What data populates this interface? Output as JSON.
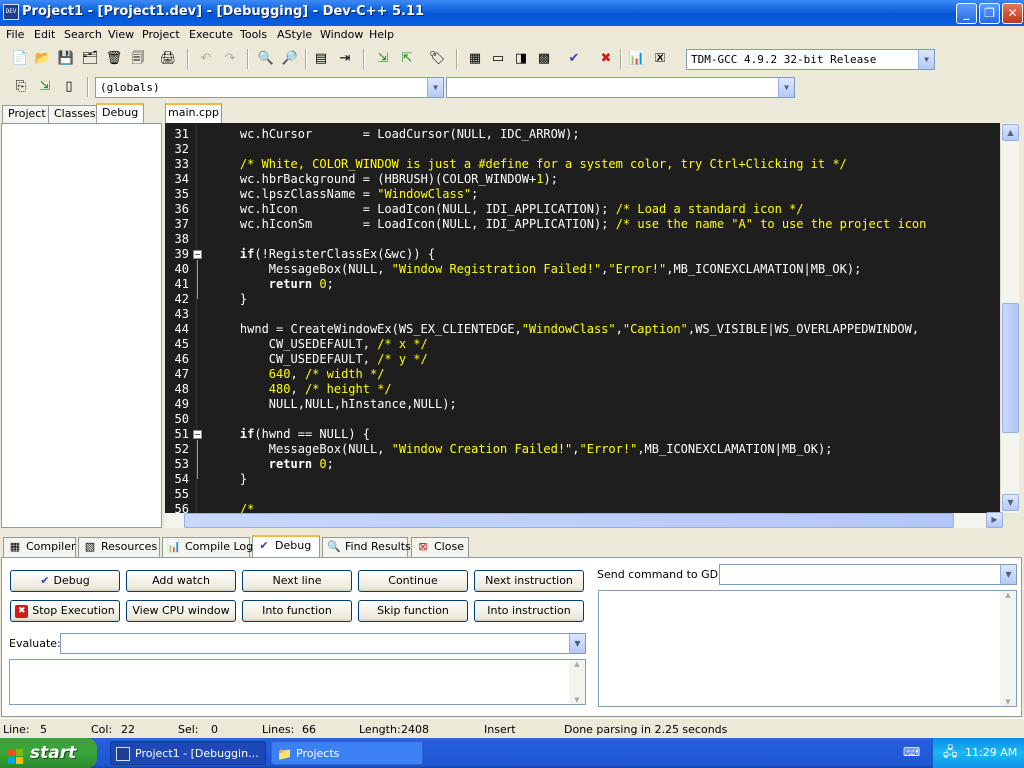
{
  "window": {
    "title": "Project1 - [Project1.dev] - [Debugging] - Dev-C++ 5.11",
    "app_icon_text": "DEV"
  },
  "menu": [
    "File",
    "Edit",
    "Search",
    "View",
    "Project",
    "Execute",
    "Tools",
    "AStyle",
    "Window",
    "Help"
  ],
  "toolbar": {
    "compiler_select": "TDM-GCC 4.9.2 32-bit Release",
    "scope_select": "(globals)",
    "member_select": ""
  },
  "left_tabs": [
    {
      "label": "Project",
      "active": false
    },
    {
      "label": "Classes",
      "active": false
    },
    {
      "label": "Debug",
      "active": true
    }
  ],
  "editor": {
    "file_tab": "main.cpp",
    "background": "#1e1e1e",
    "lines": [
      {
        "n": "31",
        "text": "    wc.hCursor       = LoadCursor(NULL, IDC_ARROW);"
      },
      {
        "n": "32",
        "text": ""
      },
      {
        "n": "33",
        "text": "    /* White, COLOR_WINDOW is just a #define for a system color, try Ctrl+Clicking it */"
      },
      {
        "n": "34",
        "text": "    wc.hbrBackground = (HBRUSH)(COLOR_WINDOW+1);"
      },
      {
        "n": "35",
        "text": "    wc.lpszClassName = \"WindowClass\";"
      },
      {
        "n": "36",
        "text": "    wc.hIcon         = LoadIcon(NULL, IDI_APPLICATION); /* Load a standard icon */"
      },
      {
        "n": "37",
        "text": "    wc.hIconSm       = LoadIcon(NULL, IDI_APPLICATION); /* use the name \"A\" to use the project icon"
      },
      {
        "n": "38",
        "text": ""
      },
      {
        "n": "39",
        "text": "    if(!RegisterClassEx(&wc)) {"
      },
      {
        "n": "40",
        "text": "        MessageBox(NULL, \"Window Registration Failed!\",\"Error!\",MB_ICONEXCLAMATION|MB_OK);"
      },
      {
        "n": "41",
        "text": "        return 0;"
      },
      {
        "n": "42",
        "text": "    }"
      },
      {
        "n": "43",
        "text": ""
      },
      {
        "n": "44",
        "text": "    hwnd = CreateWindowEx(WS_EX_CLIENTEDGE,\"WindowClass\",\"Caption\",WS_VISIBLE|WS_OVERLAPPEDWINDOW,"
      },
      {
        "n": "45",
        "text": "        CW_USEDEFAULT, /* x */"
      },
      {
        "n": "46",
        "text": "        CW_USEDEFAULT, /* y */"
      },
      {
        "n": "47",
        "text": "        640, /* width */"
      },
      {
        "n": "48",
        "text": "        480, /* height */"
      },
      {
        "n": "49",
        "text": "        NULL,NULL,hInstance,NULL);"
      },
      {
        "n": "50",
        "text": ""
      },
      {
        "n": "51",
        "text": "    if(hwnd == NULL) {"
      },
      {
        "n": "52",
        "text": "        MessageBox(NULL, \"Window Creation Failed!\",\"Error!\",MB_ICONEXCLAMATION|MB_OK);"
      },
      {
        "n": "53",
        "text": "        return 0;"
      },
      {
        "n": "54",
        "text": "    }"
      },
      {
        "n": "55",
        "text": ""
      },
      {
        "n": "56",
        "text": "    /*"
      }
    ]
  },
  "bottom_tabs": [
    {
      "label": "Compiler",
      "icon": "compiler-icon",
      "active": false
    },
    {
      "label": "Resources",
      "icon": "resources-icon",
      "active": false
    },
    {
      "label": "Compile Log",
      "icon": "compile-log-icon",
      "active": false
    },
    {
      "label": "Debug",
      "icon": "debug-check-icon",
      "active": true
    },
    {
      "label": "Find Results",
      "icon": "find-results-icon",
      "active": false
    },
    {
      "label": "Close",
      "icon": "close-tab-icon",
      "active": false
    }
  ],
  "debug_panel": {
    "buttons_row1": [
      "Debug",
      "Add watch",
      "Next line",
      "Continue",
      "Next instruction"
    ],
    "buttons_row2": [
      "Stop Execution",
      "View CPU window",
      "Into function",
      "Skip function",
      "Into instruction"
    ],
    "evaluate_label": "Evaluate:",
    "evaluate_value": "",
    "gdb_label": "Send command to GDB:",
    "gdb_value": ""
  },
  "status_bar": {
    "line_label": "Line:",
    "line_value": "5",
    "col_label": "Col:",
    "col_value": "22",
    "sel_label": "Sel:",
    "sel_value": "0",
    "lines_label": "Lines:",
    "lines_value": "66",
    "length_label": "Length:",
    "length_value": "2408",
    "mode": "Insert",
    "message": "Done parsing in 2.25 seconds"
  },
  "taskbar": {
    "start_label": "start",
    "tasks": [
      {
        "label": "Project1 - [Debuggin...",
        "active": true
      },
      {
        "label": "Projects",
        "active": false
      }
    ],
    "clock": "11:29 AM"
  },
  "colors": {
    "titlebar": "#0a5fd8",
    "editor_bg": "#1e1e1e",
    "code_text": "#ffffff",
    "code_literal": "#ffff00",
    "active_tab_accent": "#f5b841",
    "taskbar": "#245edb",
    "start_button": "#38a53a"
  }
}
